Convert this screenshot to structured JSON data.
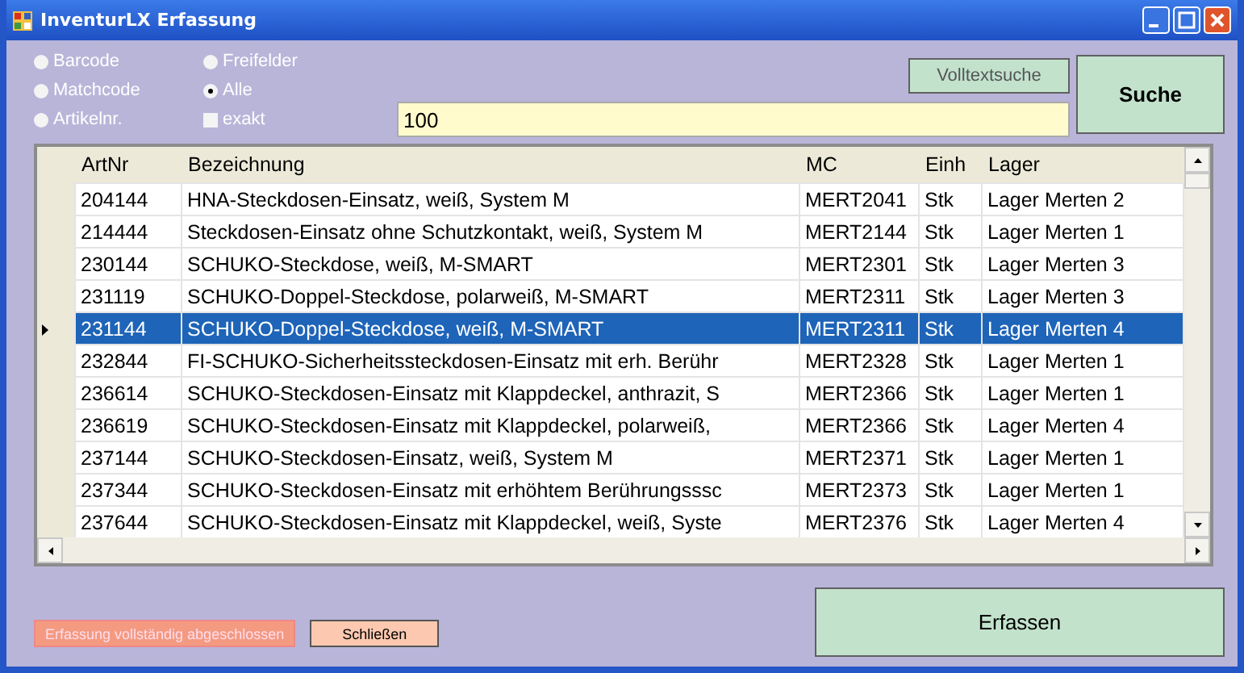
{
  "window": {
    "title": "InventurLX Erfassung"
  },
  "search_options": [
    {
      "label": "Barcode",
      "kind": "radio",
      "selected": false
    },
    {
      "label": "Freifelder",
      "kind": "radio",
      "selected": false
    },
    {
      "label": "Matchcode",
      "kind": "radio",
      "selected": false
    },
    {
      "label": "Alle",
      "kind": "radio",
      "selected": true
    },
    {
      "label": "Artikelnr.",
      "kind": "radio",
      "selected": false
    },
    {
      "label": "exakt",
      "kind": "checkbox",
      "checked": false
    }
  ],
  "search": {
    "value": "100"
  },
  "buttons": {
    "fulltext": "Volltextsuche",
    "search": "Suche",
    "complete": "Erfassung vollständig abgeschlossen",
    "close": "Schließen",
    "capture": "Erfassen"
  },
  "table": {
    "columns": [
      "ArtNr",
      "Bezeichnung",
      "MC",
      "Einh",
      "Lager"
    ],
    "rows": [
      {
        "cells": [
          "204144",
          "HNA-Steckdosen-Einsatz, weiß, System M",
          "MERT2041",
          "Stk",
          "Lager Merten 2"
        ],
        "selected": false
      },
      {
        "cells": [
          "214444",
          "Steckdosen-Einsatz ohne Schutzkontakt, weiß, System M",
          "MERT2144",
          "Stk",
          "Lager Merten 1"
        ],
        "selected": false
      },
      {
        "cells": [
          "230144",
          "SCHUKO-Steckdose, weiß, M-SMART",
          "MERT2301",
          "Stk",
          "Lager Merten 3"
        ],
        "selected": false
      },
      {
        "cells": [
          "231119",
          "SCHUKO-Doppel-Steckdose, polarweiß, M-SMART",
          "MERT2311",
          "Stk",
          "Lager Merten 3"
        ],
        "selected": false
      },
      {
        "cells": [
          "231144",
          "SCHUKO-Doppel-Steckdose, weiß, M-SMART",
          "MERT2311",
          "Stk",
          "Lager Merten 4"
        ],
        "selected": true
      },
      {
        "cells": [
          "232844",
          "FI-SCHUKO-Sicherheitssteckdosen-Einsatz mit erh. Berühr",
          "MERT2328",
          "Stk",
          "Lager Merten 1"
        ],
        "selected": false
      },
      {
        "cells": [
          "236614",
          "SCHUKO-Steckdosen-Einsatz mit Klappdeckel, anthrazit, S",
          "MERT2366",
          "Stk",
          "Lager Merten 1"
        ],
        "selected": false
      },
      {
        "cells": [
          "236619",
          "SCHUKO-Steckdosen-Einsatz mit Klappdeckel, polarweiß,",
          "MERT2366",
          "Stk",
          "Lager Merten 4"
        ],
        "selected": false
      },
      {
        "cells": [
          "237144",
          "SCHUKO-Steckdosen-Einsatz, weiß, System M",
          "MERT2371",
          "Stk",
          "Lager Merten 1"
        ],
        "selected": false
      },
      {
        "cells": [
          "237344",
          "SCHUKO-Steckdosen-Einsatz mit erhöhtem Berührungsssc",
          "MERT2373",
          "Stk",
          "Lager Merten 1"
        ],
        "selected": false
      },
      {
        "cells": [
          "237644",
          "SCHUKO-Steckdosen-Einsatz mit Klappdeckel, weiß, Syste",
          "MERT2376",
          "Stk",
          "Lager Merten 4"
        ],
        "selected": false
      }
    ]
  }
}
